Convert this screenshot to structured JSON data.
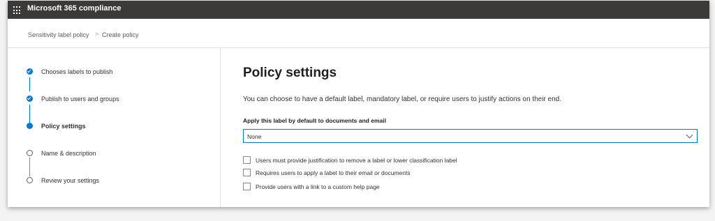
{
  "header": {
    "app_title": "Microsoft 365 compliance",
    "waffle_icon": "app-launcher-icon"
  },
  "breadcrumb": {
    "items": [
      "Sensitivity label policy",
      "Create policy"
    ],
    "separator": ">"
  },
  "steps": [
    {
      "label": "Chooses labels to publish",
      "state": "done"
    },
    {
      "label": "Publish to users and groups",
      "state": "done"
    },
    {
      "label": "Policy settings",
      "state": "current"
    },
    {
      "label": "Name & description",
      "state": "todo"
    },
    {
      "label": "Review your settings",
      "state": "todo"
    }
  ],
  "main": {
    "title": "Policy settings",
    "description": "You can choose to have a default label, mandatory label, or require users to justify actions on their end.",
    "default_label": {
      "label": "Apply this label by default to documents and email",
      "value": "None"
    },
    "checkboxes": [
      {
        "label": "Users must provide justification to remove a label or lower classification label",
        "checked": false
      },
      {
        "label": "Requires users to apply a label to their email or documents",
        "checked": false
      },
      {
        "label": "Provide users with a link to a custom help page",
        "checked": false
      }
    ]
  },
  "colors": {
    "topbar": "#3b3a39",
    "accent": "#0078d4"
  }
}
